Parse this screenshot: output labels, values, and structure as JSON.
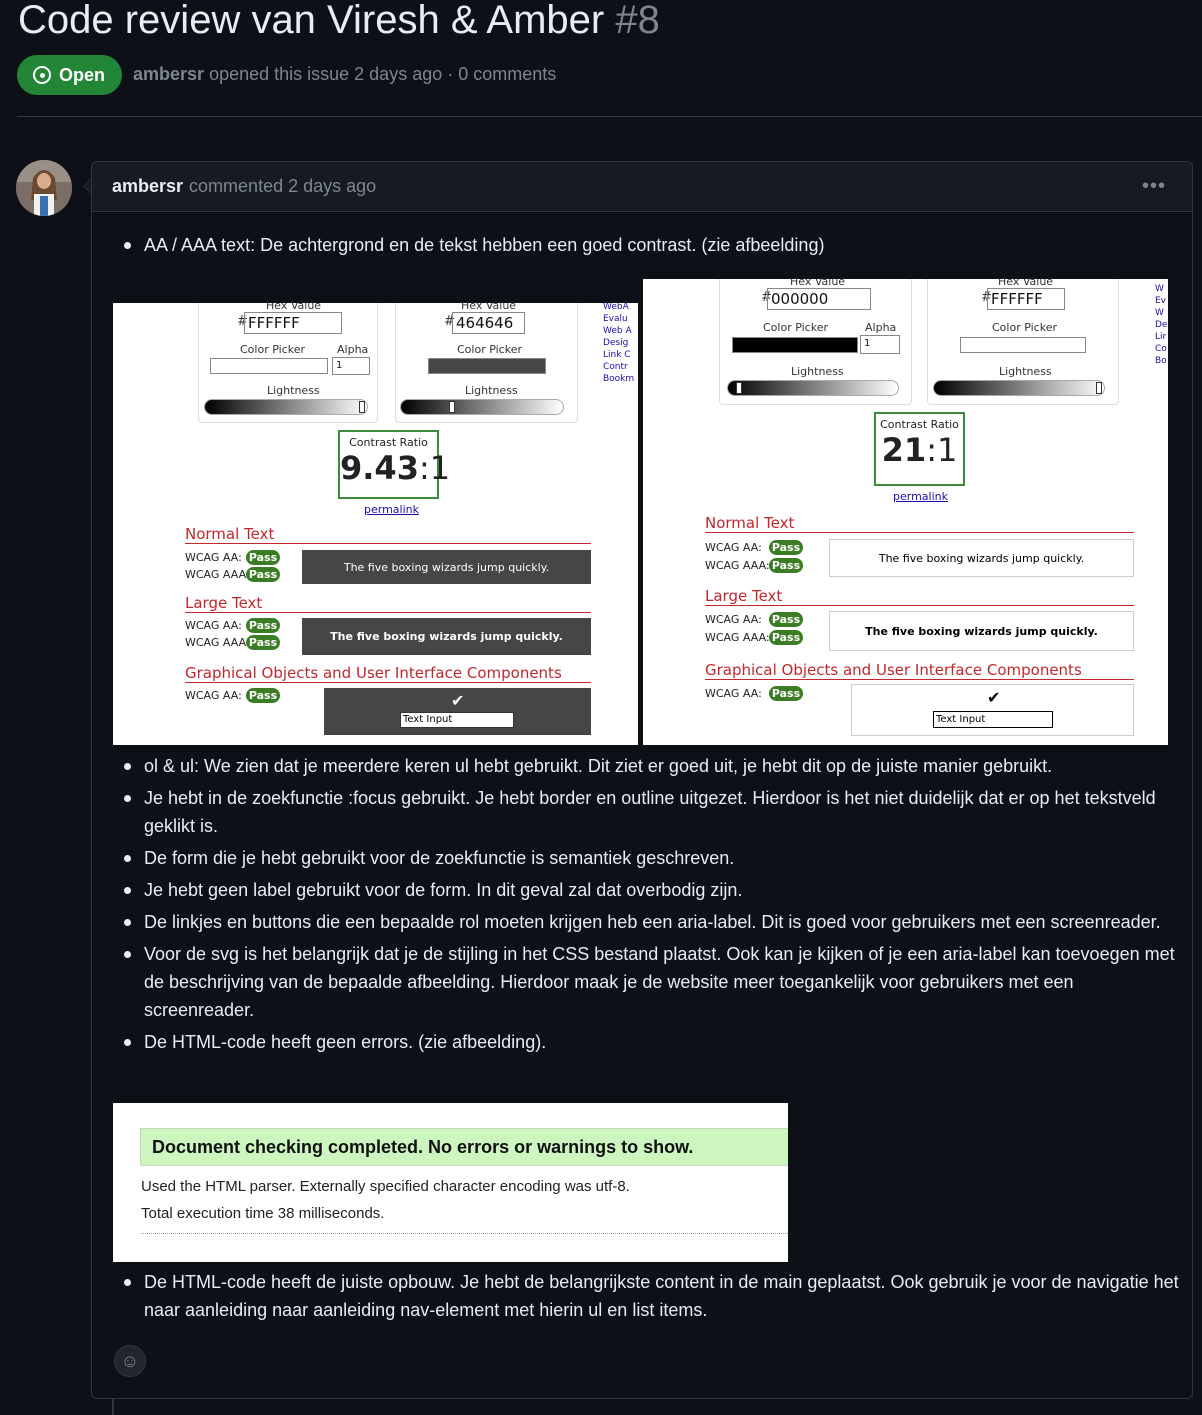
{
  "issue": {
    "title": "Code review van Viresh & Amber",
    "number": "#8",
    "state": "Open",
    "author": "ambersr",
    "meta_text": "opened this issue 2 days ago · 0 comments"
  },
  "comment": {
    "author": "ambersr",
    "meta": "commented 2 days ago",
    "menu_icon": "kebab-horizontal-icon",
    "items_top": [
      "AA / AAA text: De achtergrond en de tekst hebben een goed contrast. (zie afbeelding)"
    ],
    "items_mid": [
      "ol & ul: We zien dat je meerdere keren ul hebt gebruikt. Dit ziet er goed uit, je hebt dit op de juiste manier gebruikt.",
      "Je hebt in de zoekfunctie :focus gebruikt. Je hebt border en outline uitgezet. Hierdoor is het niet duidelijk dat er op het tekstveld geklikt is.",
      "De form die je hebt gebruikt voor de zoekfunctie is semantiek geschreven.",
      "Je hebt geen label gebruikt voor de form. In dit geval zal dat overbodig zijn.",
      "De linkjes en buttons die een bepaalde rol moeten krijgen heb een aria-label. Dit is goed voor gebruikers met een screenreader.",
      "Voor de svg is het belangrijk dat je de stijling in het CSS bestand plaatst. Ook kan je kijken of je een aria-label kan toevoegen met de beschrijving van de bepaalde afbeelding. Hierdoor maak je de website meer toegankelijk voor gebruikers met een screenreader.",
      "De HTML-code heeft geen errors. (zie afbeelding)."
    ],
    "items_end": [
      "De HTML-code heeft de juiste opbouw. Je hebt de belangrijkste content in de main geplaatst. Ook gebruik je voor de navigatie het naar aanleiding naar aanleiding nav-element met hierin ul en list items."
    ]
  },
  "contrast_shots": [
    {
      "fg_label": "Hex Value",
      "bg_label": "Hex Value",
      "fg_hex": "FFFFFF",
      "bg_hex": "464646",
      "fg_color": "#FFFFFF",
      "bg_color": "#464646",
      "color_picker": "Color Picker",
      "alpha": "Alpha",
      "alpha_value": "1",
      "lightness": "Lightness",
      "ratio_title": "Contrast Ratio",
      "ratio_value": "9.43",
      "ratio_suffix": ":1",
      "permalink": "permalink",
      "normal_text": "Normal Text",
      "large_text": "Large Text",
      "graphical": "Graphical Objects and User Interface Components",
      "wcag_aa": "WCAG AA:",
      "wcag_aaa": "WCAG AAA:",
      "pass": "Pass",
      "sample": "The five boxing wizards jump quickly.",
      "check": "✔",
      "text_input": "Text Input",
      "side_links": [
        "WebA",
        "Evalu",
        "Web A",
        "Desig",
        "Link C",
        "Contr",
        "Bookm"
      ]
    },
    {
      "fg_label": "Hex Value",
      "bg_label": "Hex Value",
      "fg_hex": "000000",
      "bg_hex": "FFFFFF",
      "fg_color": "#000000",
      "bg_color": "#FFFFFF",
      "color_picker": "Color Picker",
      "alpha": "Alpha",
      "alpha_value": "1",
      "lightness": "Lightness",
      "ratio_title": "Contrast Ratio",
      "ratio_value": "21",
      "ratio_suffix": ":1",
      "permalink": "permalink",
      "normal_text": "Normal Text",
      "large_text": "Large Text",
      "graphical": "Graphical Objects and User Interface Components",
      "wcag_aa": "WCAG AA:",
      "wcag_aaa": "WCAG AAA:",
      "pass": "Pass",
      "sample": "The five boxing wizards jump quickly.",
      "check": "✔",
      "text_input": "Text Input",
      "side_links": [
        "W",
        "Ev",
        "W",
        "De",
        "Lir",
        "Co",
        "Bo"
      ]
    }
  ],
  "validator_shot": {
    "banner": "Document checking completed. No errors or warnings to show.",
    "line1": "Used the HTML parser. Externally specified character encoding was utf-8.",
    "line2": "Total execution time 38 milliseconds."
  },
  "emoji_icon": "smiley-icon"
}
